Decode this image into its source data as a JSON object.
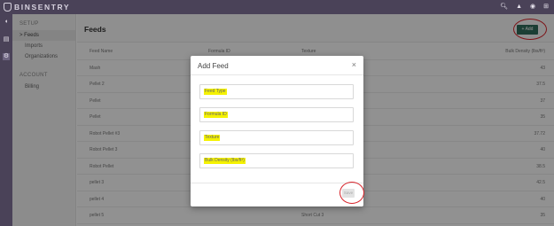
{
  "app": {
    "logo_text": "BINSENTRY",
    "top_icons": [
      "search-icon",
      "bell-icon",
      "user-icon",
      "settings-icon"
    ]
  },
  "sidebar": {
    "setup_header": "SETUP",
    "items": [
      {
        "label": "> Feeds",
        "selected": true
      },
      {
        "label": "Imports"
      },
      {
        "label": "Organizations"
      }
    ],
    "account_header": "ACCOUNT",
    "account_items": [
      {
        "label": "Billing"
      }
    ]
  },
  "main": {
    "title": "Feeds",
    "add_label": "+ Add",
    "columns": [
      "Feed Name",
      "Formula ID",
      "Texture",
      "Bulk Density (lbs/ft³)"
    ],
    "rows": [
      {
        "name": "Mash",
        "formula": "",
        "texture": "",
        "density": "43"
      },
      {
        "name": "Pellet 2",
        "formula": "",
        "texture": "",
        "density": "37.5"
      },
      {
        "name": "Pellet",
        "formula": "",
        "texture": "",
        "density": "37"
      },
      {
        "name": "Pellet",
        "formula": "",
        "texture": "",
        "density": "35"
      },
      {
        "name": "Robot Pellet #3",
        "formula": "",
        "texture": "",
        "density": "37.72"
      },
      {
        "name": "Robot Pellet 3",
        "formula": "",
        "texture": "",
        "density": "40"
      },
      {
        "name": "Robot Pellet",
        "formula": "",
        "texture": "",
        "density": "38.5"
      },
      {
        "name": "pellet 3",
        "formula": "",
        "texture": "",
        "density": "42.5"
      },
      {
        "name": "pellet 4",
        "formula": "",
        "texture": "",
        "density": "40"
      },
      {
        "name": "pellet 5",
        "formula": "",
        "texture": "Short Cut 3",
        "density": "35"
      }
    ]
  },
  "modal": {
    "title": "Add Feed",
    "close": "×",
    "fields": [
      {
        "placeholder": "Feed Type"
      },
      {
        "placeholder": "Formula ID"
      },
      {
        "placeholder": "Texture"
      },
      {
        "placeholder": "Bulk Density (lbs/ft³)"
      }
    ],
    "save_label": "Save"
  },
  "colors": {
    "topbar": "#4a4258",
    "accent": "#2f6b5a",
    "highlight": "#f5f200",
    "annotation": "#d8232a"
  }
}
